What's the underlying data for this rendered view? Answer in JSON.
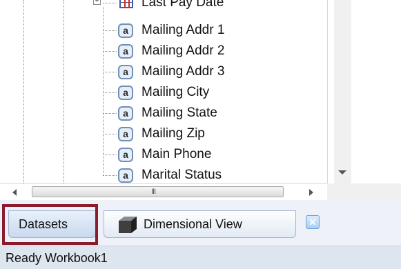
{
  "tree": {
    "partial_item": {
      "label": "Last Pay Date",
      "icon": "date-grid-icon",
      "expander": "+"
    },
    "items": [
      {
        "label": "Mailing Addr 1",
        "icon": "text-field-icon",
        "glyph": "a"
      },
      {
        "label": "Mailing Addr 2",
        "icon": "text-field-icon",
        "glyph": "a"
      },
      {
        "label": "Mailing Addr 3",
        "icon": "text-field-icon",
        "glyph": "a"
      },
      {
        "label": "Mailing City",
        "icon": "text-field-icon",
        "glyph": "a"
      },
      {
        "label": "Mailing State",
        "icon": "text-field-icon",
        "glyph": "a"
      },
      {
        "label": "Mailing Zip",
        "icon": "text-field-icon",
        "glyph": "a"
      },
      {
        "label": "Main Phone",
        "icon": "text-field-icon",
        "glyph": "a"
      },
      {
        "label": "Marital Status",
        "icon": "text-field-icon",
        "glyph": "a"
      }
    ]
  },
  "scrollbar": {
    "grip": "III"
  },
  "tabs": {
    "datasets_label": "Datasets",
    "dimensional_label": "Dimensional View",
    "close_glyph": "✕",
    "highlight_color": "#8a1c2b"
  },
  "status": {
    "text": "Ready Workbook1"
  }
}
